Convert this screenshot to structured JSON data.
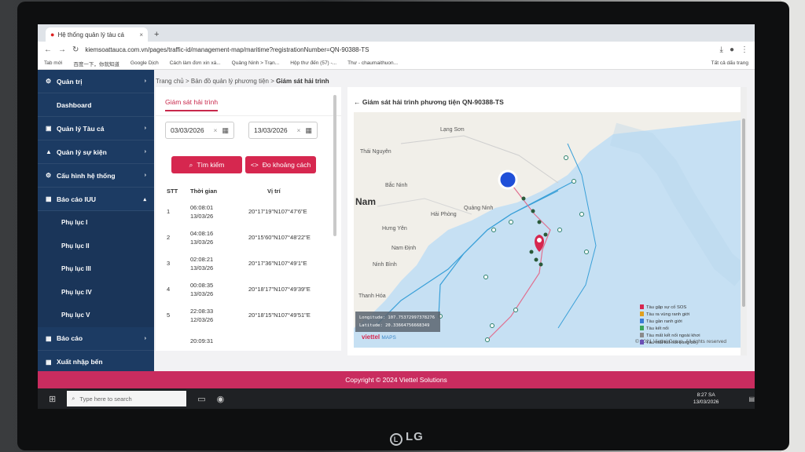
{
  "browser": {
    "tab_title": "Hệ thống quản lý tàu cá",
    "url": "kiemsoattauca.com.vn/pages/traffic-id/management-map/maritime?registrationNumber=QN-90388-TS",
    "bookmarks": [
      "Tab mới",
      "百度一下，你就知道",
      "Google Dịch",
      "Cách làm đơn xin xá...",
      "Quảng Ninh > Trạn...",
      "Hộp thư đến (57) -...",
      "Thư - chaumaithuon..."
    ],
    "bookmarks_right": "Tất cả dấu trang"
  },
  "breadcrumb": {
    "home": "Trang chủ",
    "mid": "Bản đồ quản lý phương tiện",
    "current": "Giám sát hải trình"
  },
  "sidebar": {
    "items": [
      {
        "label": "Quản trị"
      },
      {
        "label": "Dashboard"
      },
      {
        "label": "Quản lý Tàu cá"
      },
      {
        "label": "Quản lý sự kiện"
      },
      {
        "label": "Cấu hình hệ thống"
      },
      {
        "label": "Báo cáo IUU"
      }
    ],
    "subitems": [
      "Phụ lục I",
      "Phụ lục II",
      "Phụ lục III",
      "Phụ lục IV",
      "Phụ lục V"
    ],
    "bottom": [
      {
        "label": "Báo cáo"
      },
      {
        "label": "Xuất nhập bến"
      }
    ]
  },
  "panel": {
    "tab": "Giám sát hải trình",
    "date_from": "03/03/2026",
    "date_to": "13/03/2026",
    "search_label": "Tìm kiếm",
    "measure_label": "Đo khoảng cách",
    "columns": [
      "STT",
      "Thời gian",
      "Vị trí"
    ],
    "rows": [
      {
        "stt": "1",
        "time": "06:08:01",
        "date": "13/03/26",
        "pos": "20°17'19\"N107°47'6\"E"
      },
      {
        "stt": "2",
        "time": "04:08:16",
        "date": "13/03/26",
        "pos": "20°15'60\"N107°48'22\"E"
      },
      {
        "stt": "3",
        "time": "02:08:21",
        "date": "13/03/26",
        "pos": "20°17'36\"N107°49'1\"E"
      },
      {
        "stt": "4",
        "time": "00:08:35",
        "date": "13/03/26",
        "pos": "20°18'17\"N107°49'39\"E"
      },
      {
        "stt": "5",
        "time": "22:08:33",
        "date": "12/03/26",
        "pos": "20°18'15\"N107°49'51\"E"
      },
      {
        "stt": "",
        "time": "20:09:31",
        "date": "",
        "pos": ""
      }
    ]
  },
  "map": {
    "title": "Giám sát hải trình phương tiện QN-90388-TS",
    "places": [
      "Lạng Sơn",
      "Thái Nguyên",
      "Bắc Ninh",
      "Nam",
      "Quảng Ninh",
      "Hải Phòng",
      "Hưng Yên",
      "Nam Định",
      "Ninh Bình",
      "Thanh Hóa"
    ],
    "coords": [
      "Longitude: 107.75372997378276",
      "Latitude: 20.33664756668349"
    ],
    "logo": "viettel",
    "logo_sub": "MAPS",
    "copyright": "© 2021 Viettel Group. All rights reserved",
    "legend": [
      {
        "label": "Tàu gặp sự cố SOS",
        "color": "#d6274f"
      },
      {
        "label": "Tàu ra vùng ranh giới",
        "color": "#e0a020"
      },
      {
        "label": "Tàu gần ranh giới",
        "color": "#3a7bd5"
      },
      {
        "label": "Tàu kết nối",
        "color": "#3aa55a"
      },
      {
        "label": "Tàu mất kết nối ngoài khơi",
        "color": "#8a8a8a"
      },
      {
        "label": "Tàu mất kết nối trong bờ",
        "color": "#6a4fb5"
      }
    ]
  },
  "footer": "Copyright © 2024 Viettel Solutions",
  "taskbar": {
    "search": "Type here to search",
    "time": "8:27 SA",
    "date": "13/03/2026"
  },
  "monitor_brand": "LG"
}
